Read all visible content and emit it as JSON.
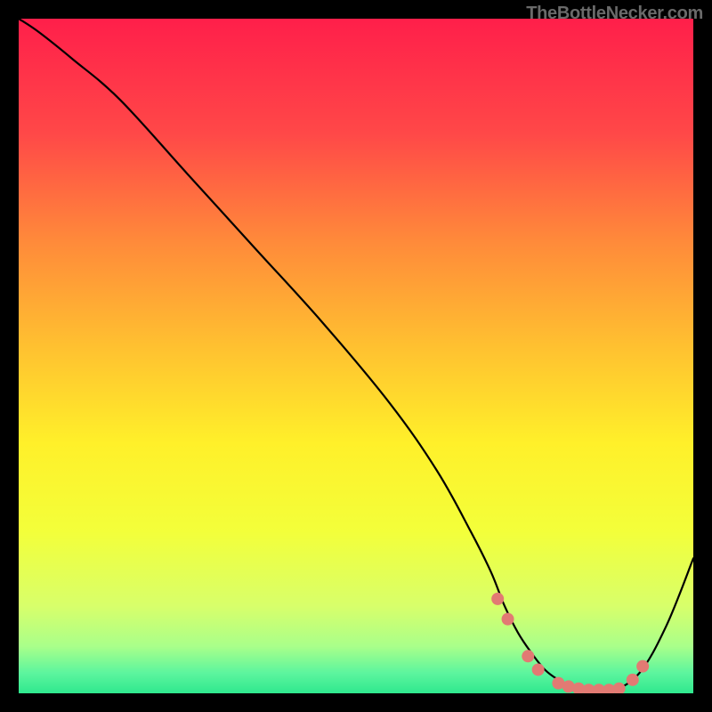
{
  "attribution": "TheBottleNecker.com",
  "chart_data": {
    "type": "line",
    "title": "",
    "xlabel": "",
    "ylabel": "",
    "xlim": [
      0,
      100
    ],
    "ylim": [
      0,
      100
    ],
    "grid": false,
    "series": [
      {
        "name": "curve",
        "x": [
          0,
          3,
          8,
          15,
          25,
          35,
          45,
          55,
          62,
          67,
          70,
          72,
          74,
          76,
          78,
          80,
          82,
          85,
          88,
          92,
          96,
          100
        ],
        "y": [
          100,
          98,
          94,
          88,
          77,
          66,
          55,
          43,
          33,
          24,
          18,
          13,
          9,
          6,
          3.5,
          2,
          1,
          0.4,
          0.4,
          3,
          10,
          20
        ]
      }
    ],
    "annotations": [
      {
        "type": "dot",
        "x": 71,
        "y": 14.0
      },
      {
        "type": "dot",
        "x": 72.5,
        "y": 11.0
      },
      {
        "type": "dot",
        "x": 75.5,
        "y": 5.5
      },
      {
        "type": "dot",
        "x": 77,
        "y": 3.5
      },
      {
        "type": "dot",
        "x": 80,
        "y": 1.5
      },
      {
        "type": "dot",
        "x": 81.5,
        "y": 1.0
      },
      {
        "type": "dot",
        "x": 83,
        "y": 0.7
      },
      {
        "type": "dot",
        "x": 84.5,
        "y": 0.5
      },
      {
        "type": "dot",
        "x": 86,
        "y": 0.5
      },
      {
        "type": "dot",
        "x": 87.5,
        "y": 0.5
      },
      {
        "type": "dot",
        "x": 89,
        "y": 0.7
      },
      {
        "type": "dot",
        "x": 91,
        "y": 2.0
      },
      {
        "type": "dot",
        "x": 92.5,
        "y": 4.0
      }
    ],
    "colors": {
      "gradient_stops": [
        {
          "offset": 0.0,
          "color": "#ff1f4a"
        },
        {
          "offset": 0.17,
          "color": "#ff4848"
        },
        {
          "offset": 0.33,
          "color": "#ff8a3a"
        },
        {
          "offset": 0.49,
          "color": "#ffc230"
        },
        {
          "offset": 0.63,
          "color": "#fff02a"
        },
        {
          "offset": 0.76,
          "color": "#f3ff3a"
        },
        {
          "offset": 0.87,
          "color": "#d8ff6a"
        },
        {
          "offset": 0.93,
          "color": "#aaff8a"
        },
        {
          "offset": 0.97,
          "color": "#5cf59e"
        },
        {
          "offset": 1.0,
          "color": "#2fe88e"
        }
      ],
      "dot_color": "#e27a73",
      "curve_color": "#000000"
    }
  }
}
